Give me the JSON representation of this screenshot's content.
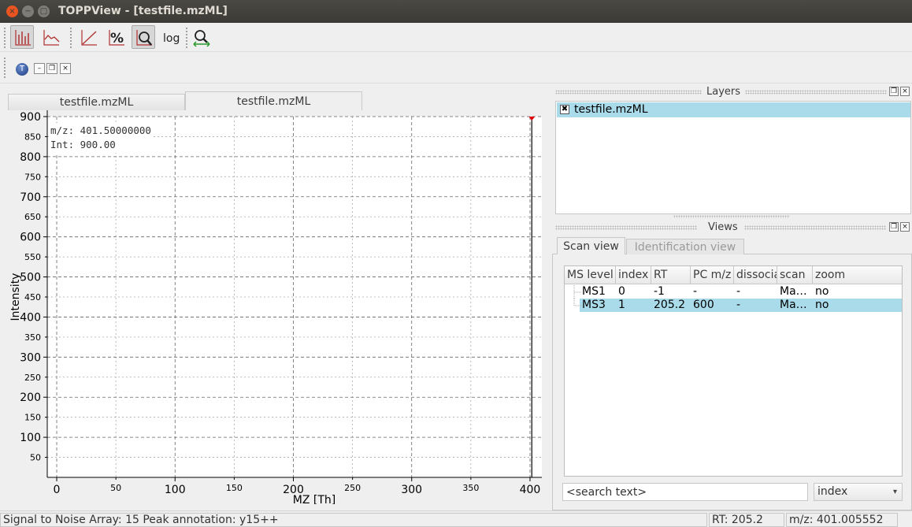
{
  "window": {
    "title": "TOPPView - [testfile.mzML]",
    "close_glyph": "×",
    "min_glyph": "−",
    "max_glyph": "□"
  },
  "toolbar": {
    "buttons": [
      {
        "name": "peak-mode-icon",
        "active": true
      },
      {
        "name": "line-mode-icon",
        "active": false
      },
      {
        "name": "linear-intensity-icon",
        "active": false
      },
      {
        "name": "percentage-intensity-icon",
        "active": false
      },
      {
        "name": "snap-intensity-icon",
        "active": true
      },
      {
        "name": "log-intensity-icon",
        "active": false,
        "label": "log"
      },
      {
        "name": "reset-zoom-icon",
        "active": false
      }
    ],
    "percent_label": "%"
  },
  "mdi": {
    "icon_label": "T",
    "min_glyph": "–",
    "restore_glyph": "❐",
    "close_glyph": "×"
  },
  "tabs": [
    {
      "label": "testfile.mzML",
      "selected": false
    },
    {
      "label": "testfile.mzML",
      "selected": true
    }
  ],
  "info_box": {
    "mz_line": "m/z: 401.50000000",
    "int_line": "Int: 900.00"
  },
  "chart_data": {
    "type": "bar",
    "xlabel": "MZ [Th]",
    "ylabel": "Intensity",
    "xlim": [
      -8,
      410
    ],
    "ylim": [
      0,
      900
    ],
    "x_ticks_major": [
      0,
      100,
      200,
      300,
      400
    ],
    "x_ticks_minor": [
      50,
      150,
      250,
      350
    ],
    "y_ticks_major": [
      100,
      200,
      300,
      400,
      500,
      600,
      700,
      800,
      900
    ],
    "y_ticks_minor": [
      50,
      150,
      250,
      350,
      450,
      550,
      650,
      750,
      850
    ],
    "grid": true,
    "peaks": [
      {
        "mz": 401.5,
        "intensity": 900
      }
    ],
    "peak_color": "#000000",
    "marker_color": "#e00000"
  },
  "layers": {
    "title": "Layers",
    "items": [
      {
        "label": "testfile.mzML",
        "checked": true
      }
    ],
    "check_glyph": "✖"
  },
  "views": {
    "title": "Views",
    "tabs": [
      {
        "label": "Scan view",
        "selected": true
      },
      {
        "label": "Identification view",
        "selected": false
      }
    ],
    "columns": [
      "MS level",
      "index",
      "RT",
      "PC m/z",
      "dissociation",
      "scan",
      "zoom"
    ],
    "rows": [
      {
        "ms_level": "MS1",
        "index": "0",
        "rt": "-1",
        "pc_mz": "-",
        "dissociation": "-",
        "scan": "Ma…",
        "zoom": "no",
        "selected": false
      },
      {
        "ms_level": "MS3",
        "index": "1",
        "rt": "205.2",
        "pc_mz": "600",
        "dissociation": "-",
        "scan": "Ma…",
        "zoom": "no",
        "selected": true
      }
    ],
    "search_placeholder": "<search text>",
    "search_field": "index",
    "select_arrow": "▾"
  },
  "panel_buttons": {
    "float_glyph": "❐",
    "close_glyph": "×"
  },
  "status": {
    "message": "Signal to Noise Array: 15 Peak annotation: y15++",
    "rt": "RT:    205.2",
    "mz": "m/z: 401.005552"
  },
  "colors": {
    "selection": "#aadbea",
    "titlebar": "#3b3a36",
    "close_button": "#e95420"
  }
}
